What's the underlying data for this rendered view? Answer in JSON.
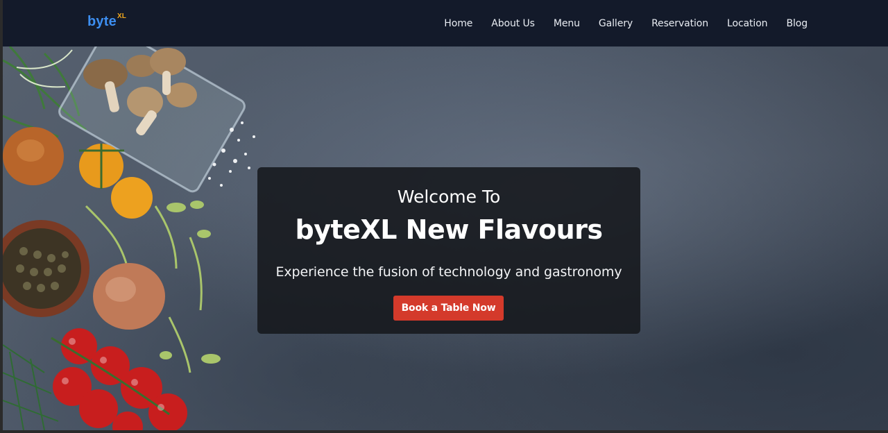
{
  "navbar": {
    "brand": {
      "name": "byte",
      "superscript": "XL"
    },
    "links": [
      "Home",
      "About Us",
      "Menu",
      "Gallery",
      "Reservation",
      "Location",
      "Blog"
    ]
  },
  "hero": {
    "welcome": "Welcome To",
    "title": "byteXL New Flavours",
    "subtitle": "Experience the fusion of technology and gastronomy",
    "cta_label": "Book a Table Now"
  },
  "colors": {
    "navbar_bg": "#131a2a",
    "brand_accent": "#3d8ef0",
    "brand_sup": "#f2a81d",
    "cta": "#d43a2b"
  }
}
